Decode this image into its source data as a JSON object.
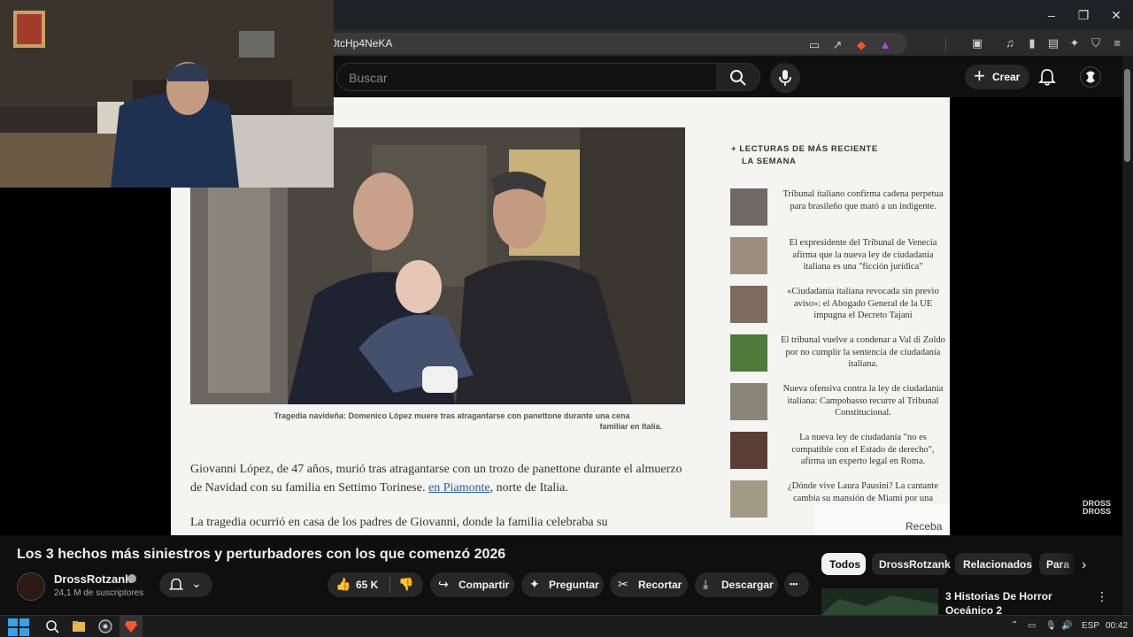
{
  "browser": {
    "url": "0tcHp4NeKA",
    "window_controls": {
      "minimize": "–",
      "maximize": "❐",
      "close": "✕"
    }
  },
  "youtube": {
    "search_placeholder": "Buscar",
    "create_label": "Crear"
  },
  "article": {
    "caption_line1": "Tragedia navideña: Domenico López muere tras atragantarse con panettone durante una cena",
    "caption_line2": "familiar en Italia.",
    "para1_text": "Giovanni López, de 47 años, murió tras atragantarse con un trozo de panettone durante el almuerzo de Navidad con su familia en Settimo Torinese.",
    "para1_link": "en Piamonte",
    "para1_end": ", norte de Italia.",
    "para2": "La tragedia ocurrió en casa de los padres de Giovanni, donde la familia celebraba su",
    "sidebar_heading_line1": "+ LECTURAS DE   MÁS RECIENTE",
    "sidebar_heading_line2": "LA SEMANA",
    "sidebar_items": [
      {
        "l1": "Tribunal italiano confirma cadena perpetua",
        "l2": "para brasileño que mató a un indigente.",
        "l3": ""
      },
      {
        "l1": "El expresidente del Tribunal de Venecia",
        "l2": "afirma que la nueva ley de ciudadanía",
        "l3": "italiana es una \"ficción jurídica\""
      },
      {
        "l1": "«Ciudadanía italiana revocada sin previo",
        "l2": "aviso»: el Abogado General de la UE",
        "l3": "impugna el Decreto Tajani"
      },
      {
        "l1": "El tribunal vuelve a condenar a Val di Zoldo",
        "l2": "por no cumplir la sentencia de ciudadanía",
        "l3": "italiana."
      },
      {
        "l1": "Nueva ofensiva contra la ley de ciudadanía",
        "l2": "italiana: Campobasso recurre al Tribunal",
        "l3": "Constitucional."
      },
      {
        "l1": "La nueva ley de ciudadanía \"no es",
        "l2": "compatible con el Estado de derecho\",",
        "l3": "afirma un experto legal en Roma."
      },
      {
        "l1": "¿Dónde vive Laura Pausini? La cantante",
        "l2": "cambia su mansión de Miami por una",
        "l3": ""
      }
    ],
    "newsletter_text": "Receba a"
  },
  "watermark": {
    "l1": "DROSS",
    "l2": "DROSS"
  },
  "video": {
    "title": "Los 3 hechos más siniestros y perturbadores con los que comenzó 2026",
    "channel_name": "DrossRotzank",
    "subscribers": "24,1 M de suscriptores",
    "likes": "65 K",
    "share_label": "Compartir",
    "ask_label": "Preguntar",
    "clip_label": "Recortar",
    "download_label": "Descargar",
    "more_label": "•••"
  },
  "chips": [
    "Todos",
    "DrossRotzank",
    "Relacionados",
    "Para"
  ],
  "recommended": {
    "title": "3 Historias De Horror Oceánico 2"
  },
  "taskbar": {
    "lang": "ESP",
    "time": "00:42"
  },
  "colors": {
    "accent_red": "#c00",
    "brave_orange": "#fb542b",
    "link": "#2a5f9e"
  }
}
